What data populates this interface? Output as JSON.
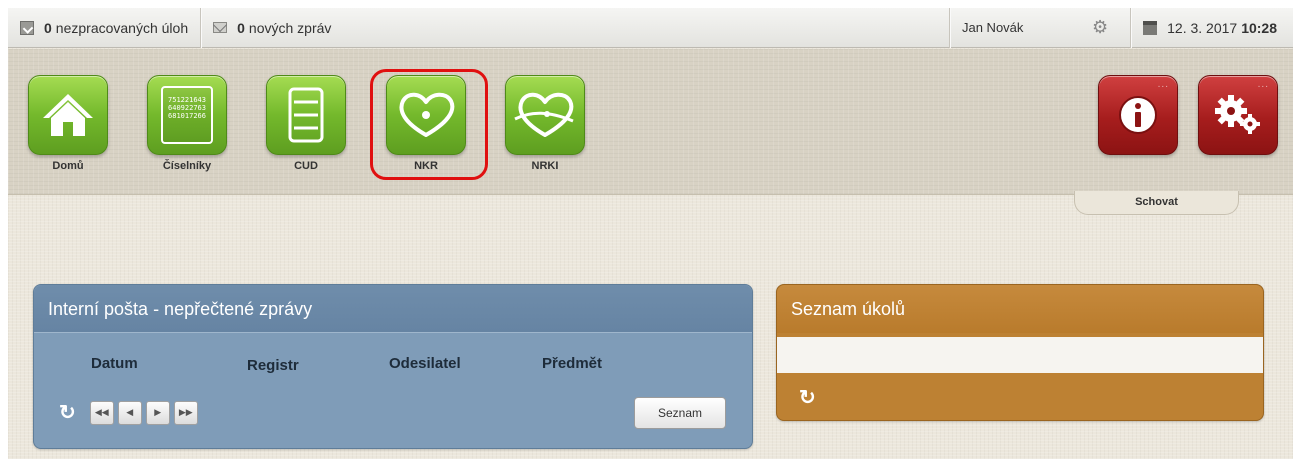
{
  "topbar": {
    "tasks_count": "0",
    "tasks_text": "nezpracovaných úloh",
    "messages_count": "0",
    "messages_text": "nových zpráv",
    "user": "Jan Novák",
    "date": "12. 3. 2017",
    "time": "10:28"
  },
  "ribbon": {
    "tiles": [
      {
        "label": "Domů",
        "icon": "home-icon"
      },
      {
        "label": "Číselníky",
        "icon": "codebook-icon",
        "icon_text": [
          "751221643",
          "640922763",
          "681017266"
        ]
      },
      {
        "label": "CUD",
        "icon": "list-icon"
      },
      {
        "label": "NKR",
        "icon": "heart-icon",
        "highlighted": true
      },
      {
        "label": "NRKI",
        "icon": "heart-arrow-icon"
      }
    ],
    "right_tiles": [
      {
        "icon": "info-icon",
        "badge": "..."
      },
      {
        "icon": "settings-gears-icon",
        "badge": "..."
      }
    ],
    "hide_label": "Schovat"
  },
  "mail_panel": {
    "title": "Interní pošta - nepřečtené zprávy",
    "columns": [
      "Datum",
      "Registr",
      "Odesilatel",
      "Předmět"
    ],
    "list_button": "Seznam"
  },
  "tasks_panel": {
    "title": "Seznam úkolů"
  },
  "colors": {
    "tile_green": "#74b92c",
    "tile_red": "#a61d1d",
    "mail_panel": "#7f9cb8",
    "tasks_panel": "#bd8133",
    "highlight": "#e01010"
  }
}
